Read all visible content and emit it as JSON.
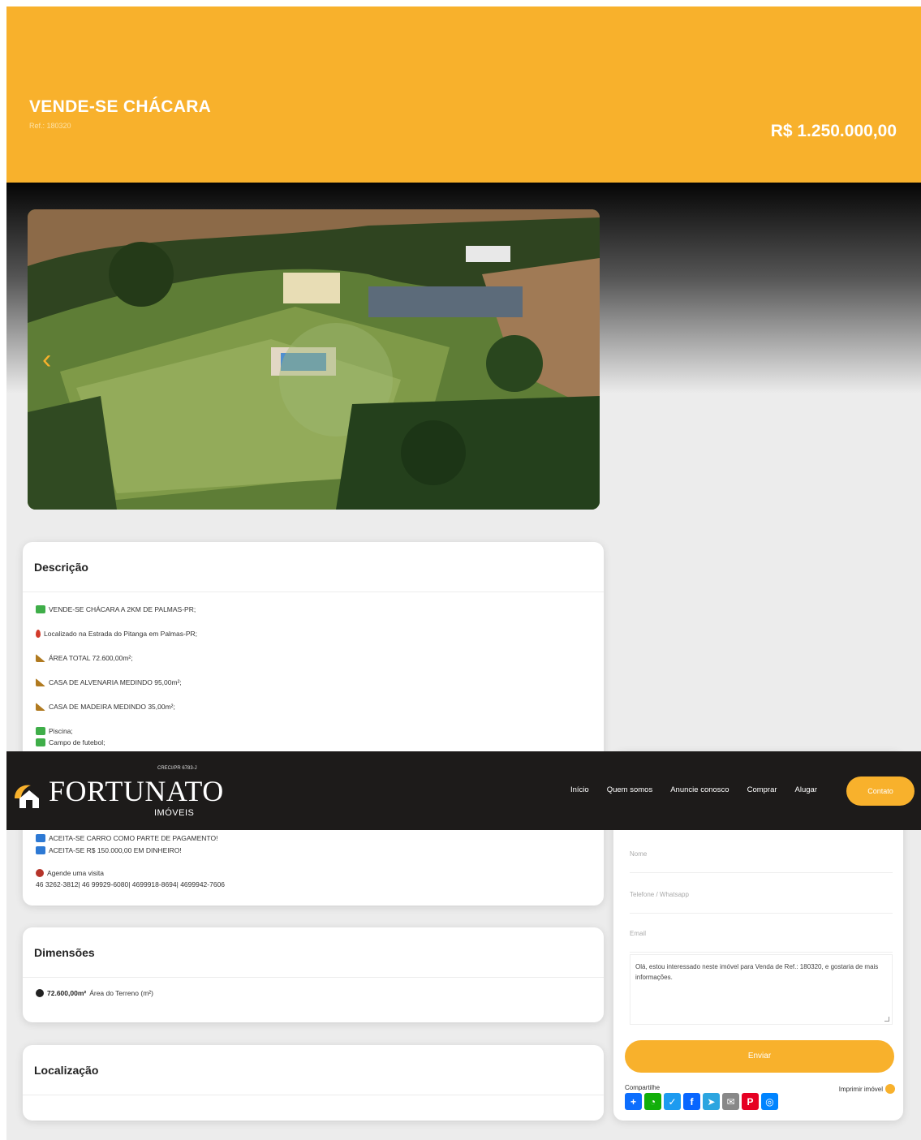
{
  "hero": {
    "title": "VENDE-SE CHÁCARA",
    "ref": "Ref.: 180320",
    "price": "R$ 1.250.000,00"
  },
  "gallery": {
    "prev_icon": "chevron-left-icon",
    "prev_glyph": "‹"
  },
  "description": {
    "heading": "Descrição",
    "items": [
      {
        "icon": "check-icon",
        "text": "VENDE-SE CHÁCARA A 2KM DE PALMAS-PR;"
      },
      {
        "icon": "pin-icon",
        "text": "Localizado na Estrada do Pitanga em Palmas-PR;"
      },
      {
        "icon": "ruler-icon",
        "text": "ÁREA TOTAL 72.600,00m²;"
      },
      {
        "icon": "ruler-icon",
        "text": "CASA DE ALVENARIA MEDINDO 95,00m²;"
      },
      {
        "icon": "ruler-icon",
        "text": "CASA DE MADEIRA MEDINDO 35,00m²;"
      },
      {
        "icon": "check-icon",
        "text": "Piscina;"
      },
      {
        "icon": "check-icon",
        "text": "Campo de futebol;"
      }
    ],
    "payment": [
      {
        "icon": "info-icon",
        "text": "ACEITA-SE CARRO COMO PARTE DE PAGAMENTO!"
      },
      {
        "icon": "info-icon",
        "text": "ACEITA-SE R$ 150.000,00 EM DINHEIRO!"
      }
    ],
    "visit_label": "Agende uma visita",
    "visit_phones": "46 3262-3812| 46 99929-6080| 4699918-8694| 4699942-7606"
  },
  "dimensions": {
    "heading": "Dimensões",
    "value": "72.600,00m²",
    "label": "Área do Terreno (m²)"
  },
  "location": {
    "heading": "Localização"
  },
  "form": {
    "name_placeholder": "Nome",
    "phone_placeholder": "Telefone / Whatsapp",
    "email_placeholder": "Email",
    "message": "Olá, estou interessado neste imóvel para Venda de Ref.: 180320, e gostaria de mais informações.",
    "send_label": "Enviar",
    "share_label": "Compartilhe",
    "print_label": "Imprimir imóvel",
    "share_buttons": [
      {
        "name": "share-add-icon",
        "glyph": "+",
        "color": "#0d6efd"
      },
      {
        "name": "whatsapp-icon",
        "glyph": "◔",
        "color": "#12af0a"
      },
      {
        "name": "twitter-icon",
        "glyph": "✓",
        "color": "#1d9bf0"
      },
      {
        "name": "facebook-icon",
        "glyph": "f",
        "color": "#0866ff"
      },
      {
        "name": "telegram-icon",
        "glyph": "➤",
        "color": "#2ca5e0"
      },
      {
        "name": "email-icon",
        "glyph": "✉",
        "color": "#888888"
      },
      {
        "name": "pinterest-icon",
        "glyph": "P",
        "color": "#e60023"
      },
      {
        "name": "messenger-icon",
        "glyph": "◎",
        "color": "#0084ff"
      }
    ]
  },
  "nav": {
    "logo_creci": "CRECI/PR 6783-J",
    "logo_name": "FORTUNATO",
    "logo_sub": "IMÓVEIS",
    "menu": [
      "Início",
      "Quem somos",
      "Anuncie conosco",
      "Comprar",
      "Alugar"
    ],
    "contact_label": "Contato"
  },
  "colors": {
    "brand": "#f8b12c",
    "nav_bg": "#1d1b1a"
  }
}
